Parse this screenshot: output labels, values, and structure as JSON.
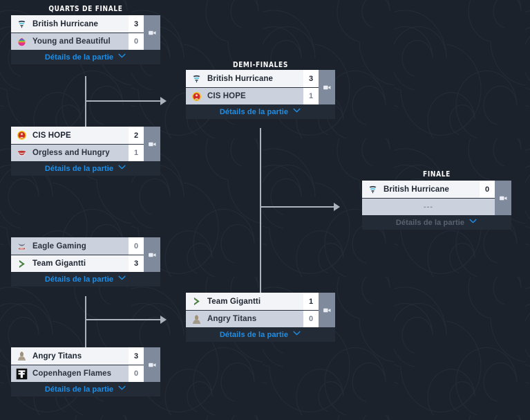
{
  "page": {
    "background_color": "#1b222c",
    "card_background": "#232b36",
    "winner_row_color": "#f2f4f7",
    "loser_row_color": "#ccd2dd",
    "accent_color": "#1e8fe8",
    "stream_cell_color": "#7f8b9c",
    "connector_color": "#aab2bd"
  },
  "rounds": [
    {
      "id": "quarter",
      "title": "QUARTS DE FINALE"
    },
    {
      "id": "semi",
      "title": "DEMI-FINALES"
    },
    {
      "id": "final",
      "title": "FINALE"
    }
  ],
  "details_label": "Détails de la partie",
  "placeholder_text": "---",
  "icons": {
    "stream": "video-camera-icon",
    "chevron": "chevron-down-icon"
  },
  "matches": [
    {
      "id": "qf1",
      "round": "quarter",
      "teams": [
        {
          "name": "British Hurricane",
          "score": "3",
          "winner": true,
          "logo": "british-hurricane-logo"
        },
        {
          "name": "Young and Beautiful",
          "score": "0",
          "winner": false,
          "logo": "young-and-beautiful-logo"
        }
      ]
    },
    {
      "id": "qf2",
      "round": "quarter",
      "teams": [
        {
          "name": "CIS HOPE",
          "score": "2",
          "winner": true,
          "logo": "cis-hope-logo"
        },
        {
          "name": "Orgless and Hungry",
          "score": "1",
          "winner": false,
          "logo": "orgless-and-hungry-logo"
        }
      ]
    },
    {
      "id": "qf3",
      "round": "quarter",
      "teams": [
        {
          "name": "Eagle Gaming",
          "score": "0",
          "winner": false,
          "logo": "eagle-gaming-logo"
        },
        {
          "name": "Team Gigantti",
          "score": "3",
          "winner": true,
          "logo": "team-gigantti-logo"
        }
      ]
    },
    {
      "id": "qf4",
      "round": "quarter",
      "teams": [
        {
          "name": "Angry Titans",
          "score": "3",
          "winner": true,
          "logo": "angry-titans-logo"
        },
        {
          "name": "Copenhagen Flames",
          "score": "0",
          "winner": false,
          "logo": "copenhagen-flames-logo"
        }
      ]
    },
    {
      "id": "sf1",
      "round": "semi",
      "teams": [
        {
          "name": "British Hurricane",
          "score": "3",
          "winner": true,
          "logo": "british-hurricane-logo"
        },
        {
          "name": "CIS HOPE",
          "score": "1",
          "winner": false,
          "logo": "cis-hope-logo"
        }
      ]
    },
    {
      "id": "sf2",
      "round": "semi",
      "teams": [
        {
          "name": "Team Gigantti",
          "score": "1",
          "winner": true,
          "logo": "team-gigantti-logo"
        },
        {
          "name": "Angry Titans",
          "score": "0",
          "winner": false,
          "logo": "angry-titans-logo"
        }
      ]
    },
    {
      "id": "f1",
      "round": "final",
      "pending": true,
      "teams": [
        {
          "name": "British Hurricane",
          "score": "0",
          "winner": true,
          "logo": "british-hurricane-logo"
        },
        {
          "name": "",
          "score": "",
          "empty": true,
          "logo": ""
        }
      ]
    }
  ]
}
